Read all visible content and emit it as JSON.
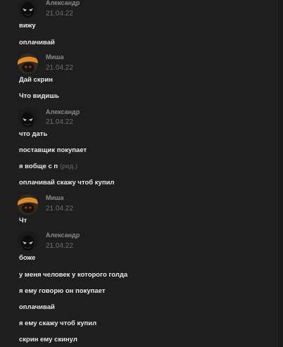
{
  "groups": [
    {
      "author": "Александр",
      "date": "21.04.22",
      "avatar": "mask-avatar",
      "messages": [
        {
          "text": "вижу"
        },
        {
          "text": "оплачивай"
        }
      ]
    },
    {
      "author": "Миша",
      "date": "21.04.22",
      "avatar": "character-avatar",
      "messages": [
        {
          "text": "Дай скрин"
        },
        {
          "text": "Что видишь"
        }
      ]
    },
    {
      "author": "Александр",
      "date": "21.04.22",
      "avatar": "mask-avatar",
      "messages": [
        {
          "text": "что дать"
        },
        {
          "text": "поставщик покупает"
        },
        {
          "text": "я вобще с п",
          "edited": "(ред.)"
        },
        {
          "text": "оплачивай скажу чтоб купил"
        }
      ]
    },
    {
      "author": "Миша",
      "date": "21.04.22",
      "avatar": "character-avatar",
      "messages": [
        {
          "text": "Чт"
        }
      ]
    },
    {
      "author": "Александр",
      "date": "21.04.22",
      "avatar": "mask-avatar",
      "messages": [
        {
          "text": "боже"
        },
        {
          "text": "у меня человек у которого голда"
        },
        {
          "text": "я ему говорю он покупает"
        },
        {
          "text": "оплачивай"
        },
        {
          "text": "я ему скажу чтоб купил"
        },
        {
          "text": "скрин ему скинул"
        }
      ]
    }
  ]
}
